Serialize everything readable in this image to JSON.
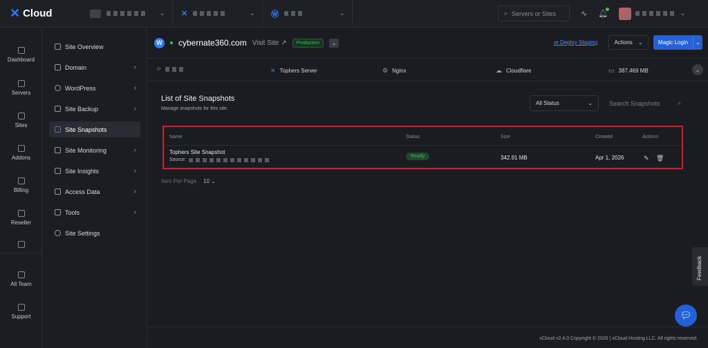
{
  "topbar": {
    "logo_text": "Cloud",
    "search_placeholder": "Servers or Sites"
  },
  "rail": [
    {
      "label": "Dashboard",
      "icon": "dashboard-icon"
    },
    {
      "label": "Servers",
      "icon": "servers-icon"
    },
    {
      "label": "Sites",
      "icon": "sites-icon"
    },
    {
      "label": "Addons",
      "icon": "addons-icon"
    },
    {
      "label": "Billing",
      "icon": "billing-icon"
    },
    {
      "label": "Reseller",
      "icon": "reseller-icon"
    },
    {
      "label": "All Team",
      "icon": "team-icon"
    },
    {
      "label": "Support",
      "icon": "support-icon"
    }
  ],
  "sidebar": [
    {
      "label": "Site Overview",
      "chevron": false
    },
    {
      "label": "Domain",
      "chevron": true
    },
    {
      "label": "WordPress",
      "chevron": true
    },
    {
      "label": "Site Backup",
      "chevron": true
    },
    {
      "label": "Site Snapshots",
      "chevron": false,
      "active": true
    },
    {
      "label": "Site Monitoring",
      "chevron": true
    },
    {
      "label": "Site Insights",
      "chevron": true
    },
    {
      "label": "Access Data",
      "chevron": true
    },
    {
      "label": "Tools",
      "chevron": true
    },
    {
      "label": "Site Settings",
      "chevron": false
    }
  ],
  "site": {
    "name": "cybernate360.com",
    "visit_label": "Visit Site ↗",
    "env_badge": "Production",
    "deploy_label": "Deploy Staging",
    "actions_label": "Actions",
    "magic_login_label": "Magic Login"
  },
  "info": {
    "ip_label": "IP",
    "server": "Tophers Server",
    "webserver": "Nginx",
    "dns": "Cloudflare",
    "disk": "387.469 MB"
  },
  "snapshots": {
    "title": "List of Site Snapshots",
    "subtitle": "Manage snapshots for this site.",
    "status_filter": "All Status",
    "search_placeholder": "Search Snapshots",
    "columns": [
      "Name",
      "Status",
      "Size",
      "Created",
      "Actions"
    ],
    "rows": [
      {
        "name": "Tophers Site Snapshot",
        "source_label": "Source:",
        "status": "Ready",
        "size": "342.91 MB",
        "created": "Apr 1, 2026"
      }
    ],
    "per_page_label": "Item Per Page",
    "per_page_value": "10"
  },
  "footer": {
    "text": "xCloud v2.4.0 Copyright © 2026 | xCloud Hosting LLC. All rights reserved."
  },
  "feedback_label": "Feedback",
  "colors": {
    "accent": "#2461d8",
    "ready": "#3fbd60",
    "highlight": "#d21f2b"
  }
}
